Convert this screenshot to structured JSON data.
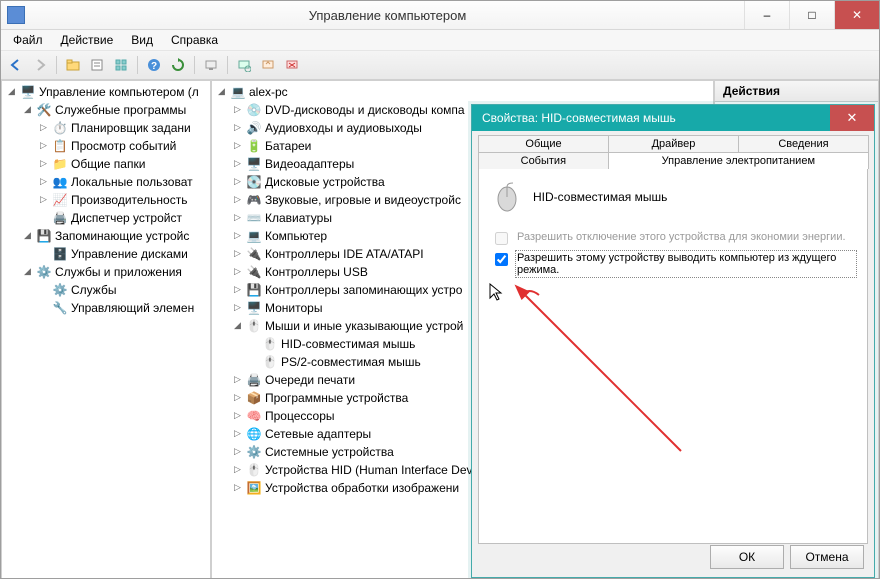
{
  "window": {
    "title": "Управление компьютером",
    "buttons": {
      "min": "–",
      "max": "□",
      "close": "✕"
    }
  },
  "menu": [
    "Файл",
    "Действие",
    "Вид",
    "Справка"
  ],
  "actions_header": "Действия",
  "left_tree": {
    "root": "Управление компьютером (л",
    "groups": [
      {
        "label": "Служебные программы",
        "items": [
          "Планировщик задани",
          "Просмотр событий",
          "Общие папки",
          "Локальные пользоват",
          "Производительность",
          "Диспетчер устройст"
        ]
      },
      {
        "label": "Запоминающие устройс",
        "items": [
          "Управление дисками"
        ]
      },
      {
        "label": "Службы и приложения",
        "items": [
          "Службы",
          "Управляющий элемен"
        ]
      }
    ]
  },
  "mid_tree": {
    "root": "alex-pc",
    "items": [
      {
        "label": "DVD-дисководы и дисководы компа",
        "exp": "▷"
      },
      {
        "label": "Аудиовходы и аудиовыходы",
        "exp": "▷"
      },
      {
        "label": "Батареи",
        "exp": "▷"
      },
      {
        "label": "Видеоадаптеры",
        "exp": "▷"
      },
      {
        "label": "Дисковые устройства",
        "exp": "▷"
      },
      {
        "label": "Звуковые, игровые и видеоустройс",
        "exp": "▷"
      },
      {
        "label": "Клавиатуры",
        "exp": "▷"
      },
      {
        "label": "Компьютер",
        "exp": "▷"
      },
      {
        "label": "Контроллеры IDE ATA/ATAPI",
        "exp": "▷"
      },
      {
        "label": "Контроллеры USB",
        "exp": "▷"
      },
      {
        "label": "Контроллеры запоминающих устро",
        "exp": "▷"
      },
      {
        "label": "Мониторы",
        "exp": "▷"
      },
      {
        "label": "Мыши и иные указывающие устрой",
        "exp": "◢",
        "children": [
          "HID-совместимая мышь",
          "PS/2-совместимая мышь"
        ]
      },
      {
        "label": "Очереди печати",
        "exp": "▷"
      },
      {
        "label": "Программные устройства",
        "exp": "▷"
      },
      {
        "label": "Процессоры",
        "exp": "▷"
      },
      {
        "label": "Сетевые адаптеры",
        "exp": "▷"
      },
      {
        "label": "Системные устройства",
        "exp": "▷"
      },
      {
        "label": "Устройства HID (Human Interface Dev",
        "exp": "▷"
      },
      {
        "label": "Устройства обработки изображени",
        "exp": "▷"
      }
    ]
  },
  "dialog": {
    "title": "Свойства: HID-совместимая мышь",
    "close": "✕",
    "tabs_row1": [
      "Общие",
      "Драйвер",
      "Сведения"
    ],
    "tabs_row2": [
      "События",
      "Управление электропитанием"
    ],
    "device_name": "HID-совместимая мышь",
    "check1": "Разрешить отключение этого устройства для экономии энергии.",
    "check2": "Разрешить этому устройству выводить компьютер из ждущего режима.",
    "ok": "ОК",
    "cancel": "Отмена"
  }
}
